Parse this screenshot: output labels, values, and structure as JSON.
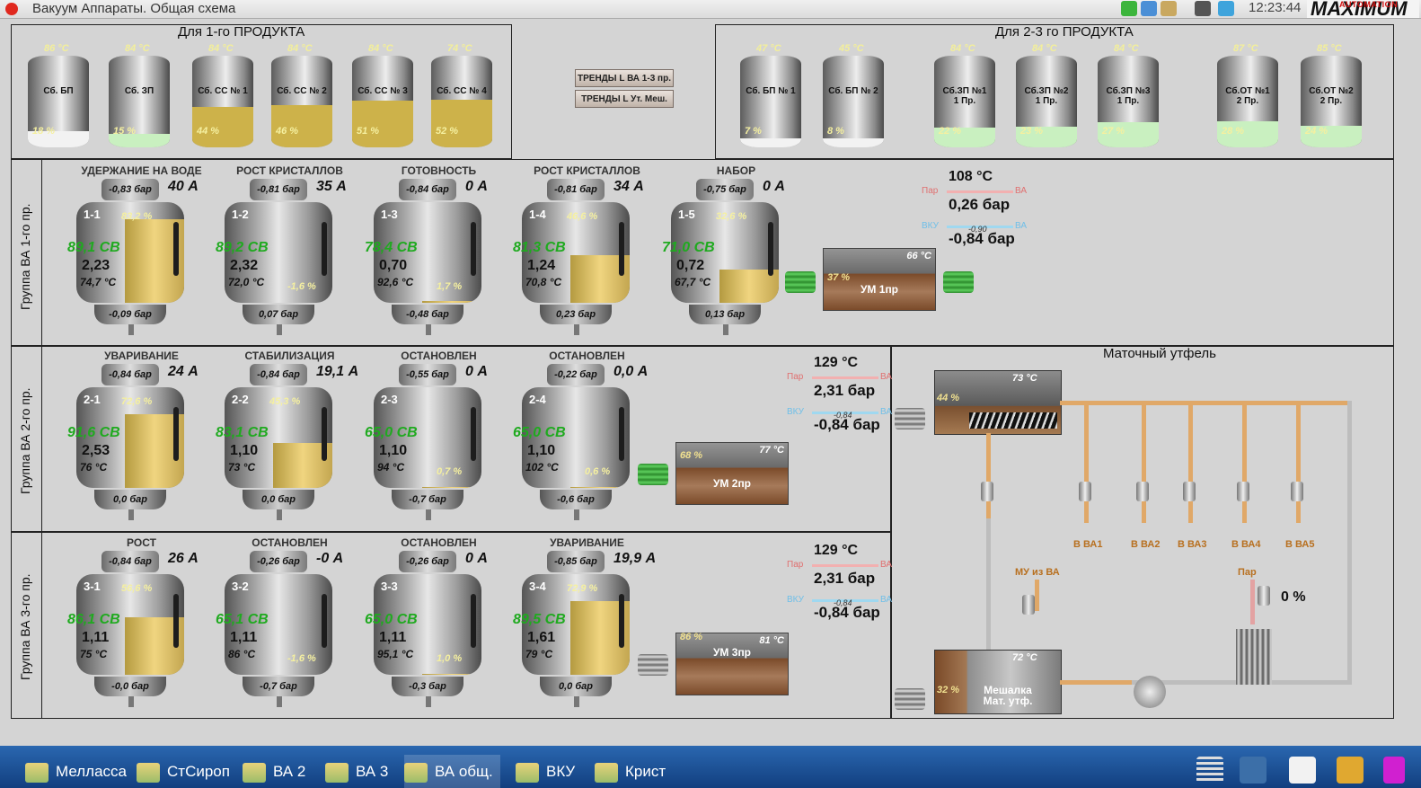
{
  "window": {
    "title": "Вакуум Аппараты. Общая схема",
    "clock": "12:23:44"
  },
  "logo": {
    "main": "MAXIMUM",
    "sub": "AUTOMATION"
  },
  "product1": {
    "title": "Для 1-го ПРОДУКТА",
    "tanks": [
      {
        "temp": "86 °C",
        "name": "Сб. БП",
        "pct": "18 %",
        "fill": 0.18,
        "color": "#f2f2f2"
      },
      {
        "temp": "84 °C",
        "name": "Сб. ЗП",
        "pct": "15 %",
        "fill": 0.15,
        "color": "#c9f0c0"
      },
      {
        "temp": "84 °C",
        "name": "Сб. СС № 1",
        "pct": "44 %",
        "fill": 0.44,
        "color": "#cdb24a"
      },
      {
        "temp": "84 °C",
        "name": "Сб. СС № 2",
        "pct": "46 %",
        "fill": 0.46,
        "color": "#cdb24a"
      },
      {
        "temp": "84 °C",
        "name": "Сб. СС № 3",
        "pct": "51 %",
        "fill": 0.51,
        "color": "#cdb24a"
      },
      {
        "temp": "74 °C",
        "name": "Сб. СС № 4",
        "pct": "52 %",
        "fill": 0.52,
        "color": "#cdb24a"
      }
    ]
  },
  "buttons": {
    "trend1": "ТРЕНДЫ L ВА 1-3 пр.",
    "trend2": "ТРЕНДЫ L Ут. Меш."
  },
  "product23": {
    "title": "Для 2-3 го ПРОДУКТА",
    "tanks": [
      {
        "temp": "47 °C",
        "name": "Сб. БП № 1",
        "pct": "7 %",
        "fill": 0.07,
        "color": "#f2f2f2"
      },
      {
        "temp": "45 °C",
        "name": "Сб. БП № 2",
        "pct": "8 %",
        "fill": 0.08,
        "color": "#f2f2f2"
      },
      {
        "temp": "84 °C",
        "name": "Сб.ЗП №1 1 Пр.",
        "pct": "22 %",
        "fill": 0.22,
        "color": "#c9f0c0"
      },
      {
        "temp": "84 °C",
        "name": "Сб.ЗП №2 1 Пр.",
        "pct": "23 %",
        "fill": 0.23,
        "color": "#c9f0c0"
      },
      {
        "temp": "84 °C",
        "name": "Сб.ЗП №3 1 Пр.",
        "pct": "27 %",
        "fill": 0.27,
        "color": "#c9f0c0"
      },
      {
        "temp": "87 °C",
        "name": "Сб.ОТ №1 2 Пр.",
        "pct": "28 %",
        "fill": 0.28,
        "color": "#c9f0c0"
      },
      {
        "temp": "85 °C",
        "name": "Сб.ОТ №2 2 Пр.",
        "pct": "24 %",
        "fill": 0.24,
        "color": "#c9f0c0"
      }
    ]
  },
  "groups": [
    {
      "label": "Группа ВА 1-го пр.",
      "vas": [
        {
          "status": "УДЕРЖАНИЕ НА ВОДЕ",
          "top": "-0,83 бар",
          "amp": "40 А",
          "id": "1-1",
          "lvl_text": "83,2 %",
          "level": 0.83,
          "cb": "89,1 СВ",
          "v2": "2,23",
          "temp": "74,7 °C",
          "bottom": "-0,09 бар"
        },
        {
          "status": "РОСТ КРИСТАЛЛОВ",
          "top": "-0,81 бар",
          "amp": "35 А",
          "id": "1-2",
          "lvl_text": "-1,6 %",
          "level": 0.0,
          "cb": "89,2 СВ",
          "v2": "2,32",
          "temp": "72,0 °C",
          "bottom": "0,07 бар"
        },
        {
          "status": "ГОТОВНОСТЬ",
          "top": "-0,84 бар",
          "amp": "0 А",
          "id": "1-3",
          "lvl_text": "1,7 %",
          "level": 0.02,
          "cb": "78,4 СВ",
          "v2": "0,70",
          "temp": "92,6 °C",
          "bottom": "-0,48 бар"
        },
        {
          "status": "РОСТ КРИСТАЛЛОВ",
          "top": "-0,81 бар",
          "amp": "34 А",
          "id": "1-4",
          "lvl_text": "46,6 %",
          "level": 0.47,
          "cb": "81,3 СВ",
          "v2": "1,24",
          "temp": "70,8 °C",
          "bottom": "0,23 бар"
        },
        {
          "status": "НАБОР",
          "top": "-0,75 бар",
          "amp": "0 А",
          "id": "1-5",
          "lvl_text": "32,6 %",
          "level": 0.33,
          "cb": "71,0 СВ",
          "v2": "0,72",
          "temp": "67,7 °C",
          "bottom": "0,13 бар"
        }
      ],
      "um": {
        "temp": "66 °C",
        "pct": "37 %",
        "name": "УМ 1пр"
      },
      "steam": {
        "temp": "108 °C",
        "par": "Пар",
        "vku": "ВКУ",
        "va": "ВА",
        "par_bar": "0,26 бар",
        "vku_bar": "-0,84 бар",
        "sub": "-0,90"
      }
    },
    {
      "label": "Группа ВА 2-го пр.",
      "vas": [
        {
          "status": "УВАРИВАНИЕ",
          "top": "-0,84 бар",
          "amp": "24 А",
          "id": "2-1",
          "lvl_text": "72,6 %",
          "level": 0.73,
          "cb": "91,6 СВ",
          "v2": "2,53",
          "temp": "76 °C",
          "bottom": "0,0 бар"
        },
        {
          "status": "СТАБИЛИЗАЦИЯ",
          "top": "-0,84 бар",
          "amp": "19,1 А",
          "id": "2-2",
          "lvl_text": "45,3 %",
          "level": 0.45,
          "cb": "83,1 СВ",
          "v2": "1,10",
          "temp": "73 °C",
          "bottom": "0,0 бар"
        },
        {
          "status": "ОСТАНОВЛЕН",
          "top": "-0,55 бар",
          "amp": "0 А",
          "id": "2-3",
          "lvl_text": "0,7 %",
          "level": 0.01,
          "cb": "65,0 СВ",
          "v2": "1,10",
          "temp": "94 °C",
          "bottom": "-0,7 бар"
        },
        {
          "status": "ОСТАНОВЛЕН",
          "top": "-0,22 бар",
          "amp": "0,0 А",
          "id": "2-4",
          "lvl_text": "0,6 %",
          "level": 0.01,
          "cb": "65,0 СВ",
          "v2": "1,10",
          "temp": "102 °C",
          "bottom": "-0,6 бар"
        }
      ],
      "um": {
        "temp": "77 °C",
        "pct": "68 %",
        "name": "УМ 2пр"
      },
      "steam": {
        "temp": "129 °C",
        "par": "Пар",
        "vku": "ВКУ",
        "va": "ВА",
        "par_bar": "2,31 бар",
        "vku_bar": "-0,84 бар",
        "sub": "-0,84"
      }
    },
    {
      "label": "Группа ВА 3-го пр.",
      "vas": [
        {
          "status": "РОСТ",
          "top": "-0,84 бар",
          "amp": "26 А",
          "id": "3-1",
          "lvl_text": "56,6 %",
          "level": 0.57,
          "cb": "86,1 СВ",
          "v2": "1,11",
          "temp": "75 °C",
          "bottom": "-0,0 бар"
        },
        {
          "status": "ОСТАНОВЛЕН",
          "top": "-0,26 бар",
          "amp": "-0 А",
          "id": "3-2",
          "lvl_text": "-1,6 %",
          "level": 0.0,
          "cb": "65,1 СВ",
          "v2": "1,11",
          "temp": "86 °C",
          "bottom": "-0,7 бар"
        },
        {
          "status": "ОСТАНОВЛЕН",
          "top": "-0,26 бар",
          "amp": "0 А",
          "id": "3-3",
          "lvl_text": "1,0 %",
          "level": 0.01,
          "cb": "65,0 СВ",
          "v2": "1,11",
          "temp": "95,1 °C",
          "bottom": "-0,3 бар"
        },
        {
          "status": "УВАРИВАНИЕ",
          "top": "-0,85 бар",
          "amp": "19,9 А",
          "id": "3-4",
          "lvl_text": "72,9 %",
          "level": 0.73,
          "cb": "89,5 СВ",
          "v2": "1,61",
          "temp": "79 °C",
          "bottom": "0,0 бар"
        }
      ],
      "um": {
        "temp": "81 °C",
        "pct": "86 %",
        "name": "УМ 3пр"
      },
      "steam": {
        "temp": "129 °C",
        "par": "Пар",
        "vku": "ВКУ",
        "va": "ВА",
        "par_bar": "2,31 бар",
        "vku_bar": "-0,84 бар",
        "sub": "-0,84"
      }
    }
  ],
  "mother": {
    "title": "Маточный утфель",
    "top_tank": {
      "temp": "73 °C",
      "pct": "44 %"
    },
    "bottom_tank": {
      "temp": "72 °C",
      "pct": "32 %",
      "name": "Мешалка Мат. утф."
    },
    "outputs": [
      "В ВА1",
      "В ВА2",
      "В ВА3",
      "В ВА4",
      "В ВА5"
    ],
    "mu_label": "МУ из ВА",
    "par_label": "Пар",
    "valve_pct": "0 %"
  },
  "taskbar": {
    "items": [
      "Мелласса",
      "СтСироп",
      "ВА 2",
      "ВА 3",
      "ВА общ.",
      "ВКУ",
      "Крист"
    ],
    "active": 4
  }
}
